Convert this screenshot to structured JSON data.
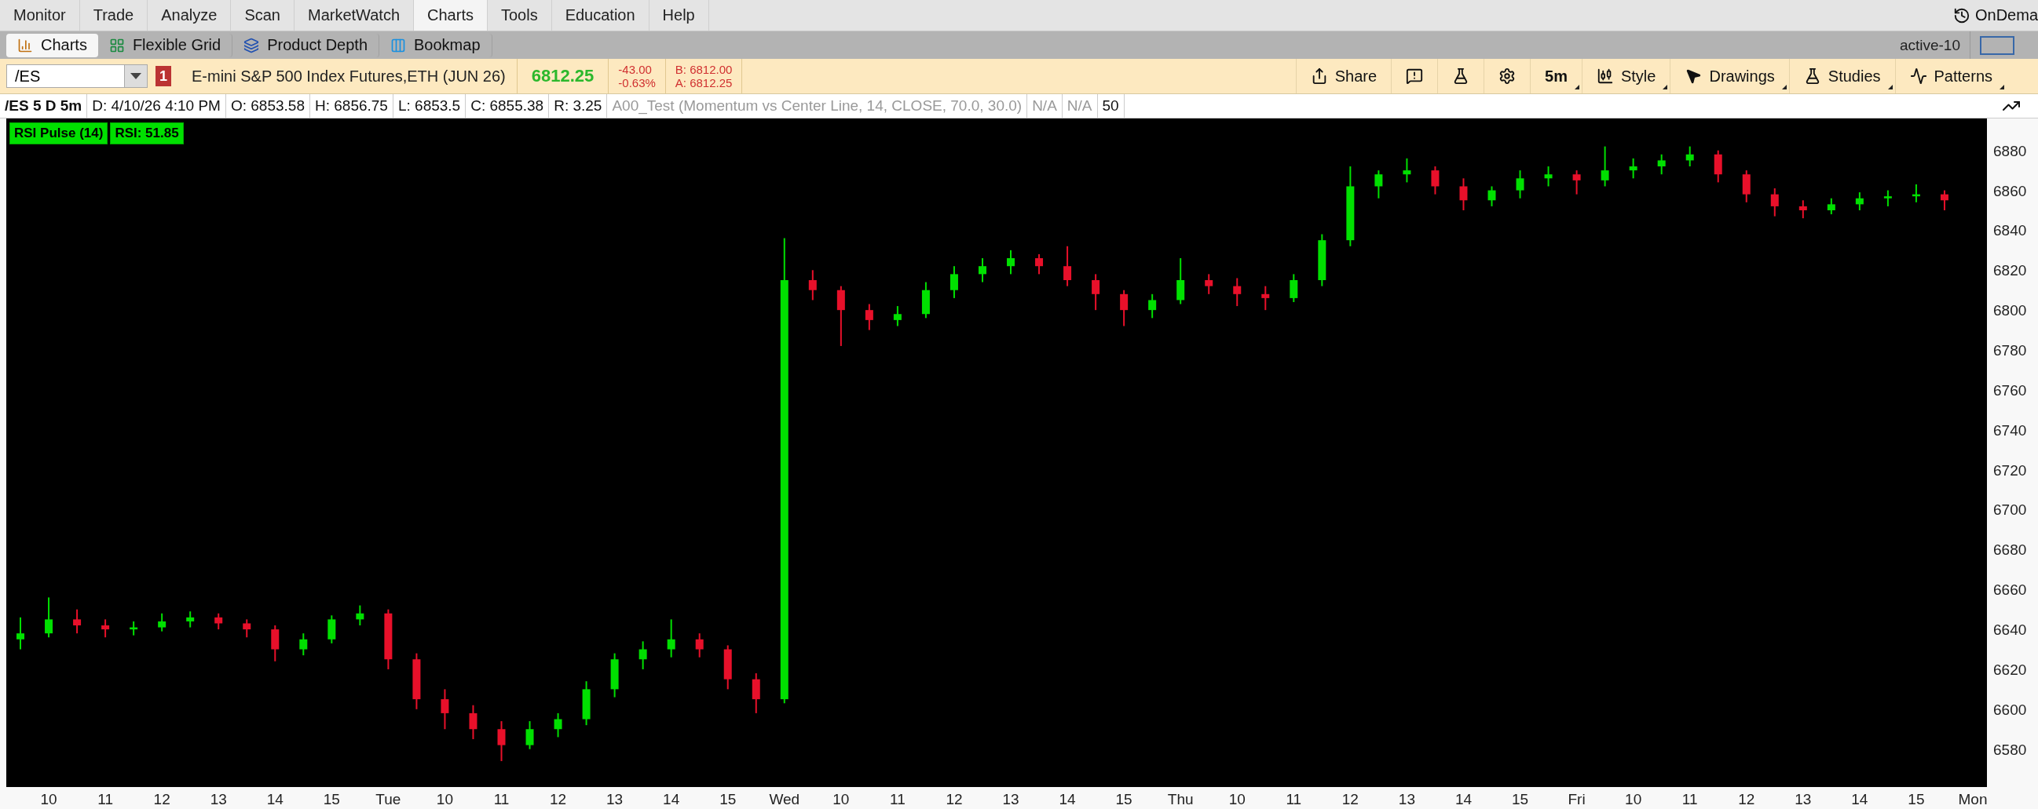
{
  "menu_tabs": [
    {
      "label": "Monitor",
      "selected": false
    },
    {
      "label": "Trade",
      "selected": false
    },
    {
      "label": "Analyze",
      "selected": false
    },
    {
      "label": "Scan",
      "selected": false
    },
    {
      "label": "MarketWatch",
      "selected": false
    },
    {
      "label": "Charts",
      "selected": true
    },
    {
      "label": "Tools",
      "selected": false
    },
    {
      "label": "Education",
      "selected": false
    },
    {
      "label": "Help",
      "selected": false
    }
  ],
  "ondemand": "OnDema",
  "sub_tabs": [
    {
      "label": "Charts",
      "kind": "bars",
      "selected": true
    },
    {
      "label": "Flexible Grid",
      "kind": "grid",
      "selected": false
    },
    {
      "label": "Product Depth",
      "kind": "depth",
      "selected": false
    },
    {
      "label": "Bookmap",
      "kind": "columns",
      "selected": false
    }
  ],
  "workspace": "active-10",
  "symbol_bar": {
    "symbol": "/ES",
    "alert_count": "1",
    "description": "E-mini S&P 500 Index Futures,ETH (JUN 26)",
    "last": "6812.25",
    "change": "-43.00",
    "change_pct": "-0.63%",
    "bid": "B: 6812.00",
    "ask": "A: 6812.25"
  },
  "toolbar": [
    {
      "kind": "share",
      "label": "Share"
    },
    {
      "kind": "alert"
    },
    {
      "kind": "flask"
    },
    {
      "kind": "gear"
    },
    {
      "kind": "interval",
      "label": "5m",
      "has_menu": true
    },
    {
      "kind": "style",
      "label": "Style",
      "has_menu": true
    },
    {
      "kind": "drawings",
      "label": "Drawings",
      "has_menu": true
    },
    {
      "kind": "studies",
      "label": "Studies",
      "has_menu": true
    },
    {
      "kind": "patterns",
      "label": "Patterns",
      "has_menu": true
    }
  ],
  "info_bar": [
    {
      "kind": "title",
      "text": "/ES 5 D 5m"
    },
    {
      "kind": "value",
      "text": "D: 4/10/26 4:10 PM"
    },
    {
      "kind": "value",
      "text": "O: 6853.58"
    },
    {
      "kind": "value",
      "text": "H: 6856.75"
    },
    {
      "kind": "value",
      "text": "L: 6853.5"
    },
    {
      "kind": "value",
      "text": "C: 6855.38"
    },
    {
      "kind": "value",
      "text": "R: 3.25"
    },
    {
      "kind": "study",
      "text": "A00_Test (Momentum vs Center Line, 14, CLOSE, 70.0, 30.0)"
    },
    {
      "kind": "study",
      "text": "N/A"
    },
    {
      "kind": "study",
      "text": "N/A"
    },
    {
      "kind": "value",
      "text": "50"
    }
  ],
  "study_labels": [
    "RSI Pulse (14)",
    "RSI: 51.85"
  ],
  "chart_data": {
    "type": "candlestick",
    "categories": [
      null,
      "10",
      null,
      "11",
      null,
      "12",
      null,
      "13",
      null,
      "14",
      null,
      "15",
      null,
      "Tue",
      null,
      "10",
      null,
      "11",
      null,
      "12",
      null,
      "13",
      null,
      "14",
      null,
      "15",
      null,
      "Wed",
      null,
      "10",
      null,
      "11",
      null,
      "12",
      null,
      "13",
      null,
      "14",
      null,
      "15",
      null,
      "Thu",
      null,
      "10",
      null,
      "11",
      null,
      "12",
      null,
      "13",
      null,
      "14",
      null,
      "15",
      null,
      "Fri",
      null,
      "10",
      null,
      "11",
      null,
      "12",
      null,
      "13",
      null,
      "14",
      null,
      "15",
      null,
      "Mon"
    ],
    "ohlc": [
      [
        6635,
        6646,
        6630,
        6638
      ],
      [
        6638,
        6656,
        6636,
        6645
      ],
      [
        6645,
        6650,
        6638,
        6642
      ],
      [
        6642,
        6645,
        6636,
        6640
      ],
      [
        6640,
        6644,
        6637,
        6641
      ],
      [
        6641,
        6648,
        6639,
        6644
      ],
      [
        6644,
        6649,
        6641,
        6646
      ],
      [
        6646,
        6648,
        6640,
        6643
      ],
      [
        6643,
        6645,
        6636,
        6640
      ],
      [
        6640,
        6642,
        6624,
        6630
      ],
      [
        6630,
        6638,
        6627,
        6635
      ],
      [
        6635,
        6647,
        6633,
        6645
      ],
      [
        6645,
        6652,
        6642,
        6648
      ],
      [
        6648,
        6650,
        6620,
        6625
      ],
      [
        6625,
        6628,
        6600,
        6605
      ],
      [
        6605,
        6610,
        6590,
        6598
      ],
      [
        6598,
        6602,
        6585,
        6590
      ],
      [
        6590,
        6594,
        6574,
        6582
      ],
      [
        6582,
        6594,
        6580,
        6590
      ],
      [
        6590,
        6598,
        6586,
        6595
      ],
      [
        6595,
        6614,
        6592,
        6610
      ],
      [
        6610,
        6628,
        6606,
        6625
      ],
      [
        6625,
        6634,
        6620,
        6630
      ],
      [
        6630,
        6645,
        6626,
        6635
      ],
      [
        6635,
        6638,
        6626,
        6630
      ],
      [
        6630,
        6632,
        6610,
        6615
      ],
      [
        6615,
        6618,
        6598,
        6605
      ],
      [
        6605,
        6836,
        6603,
        6815
      ],
      [
        6815,
        6820,
        6805,
        6810
      ],
      [
        6810,
        6812,
        6782,
        6800
      ],
      [
        6800,
        6803,
        6790,
        6795
      ],
      [
        6795,
        6802,
        6792,
        6798
      ],
      [
        6798,
        6814,
        6796,
        6810
      ],
      [
        6810,
        6822,
        6806,
        6818
      ],
      [
        6818,
        6826,
        6814,
        6822
      ],
      [
        6822,
        6830,
        6818,
        6826
      ],
      [
        6826,
        6828,
        6818,
        6822
      ],
      [
        6822,
        6832,
        6812,
        6815
      ],
      [
        6815,
        6818,
        6800,
        6808
      ],
      [
        6808,
        6810,
        6792,
        6800
      ],
      [
        6800,
        6808,
        6796,
        6805
      ],
      [
        6805,
        6826,
        6803,
        6815
      ],
      [
        6815,
        6818,
        6808,
        6812
      ],
      [
        6812,
        6816,
        6802,
        6808
      ],
      [
        6808,
        6812,
        6800,
        6806
      ],
      [
        6806,
        6818,
        6804,
        6815
      ],
      [
        6815,
        6838,
        6812,
        6835
      ],
      [
        6835,
        6872,
        6832,
        6862
      ],
      [
        6862,
        6870,
        6856,
        6868
      ],
      [
        6868,
        6876,
        6864,
        6870
      ],
      [
        6870,
        6872,
        6858,
        6862
      ],
      [
        6862,
        6866,
        6850,
        6855
      ],
      [
        6855,
        6862,
        6852,
        6860
      ],
      [
        6860,
        6870,
        6856,
        6866
      ],
      [
        6866,
        6872,
        6862,
        6868
      ],
      [
        6868,
        6870,
        6858,
        6865
      ],
      [
        6865,
        6882,
        6862,
        6870
      ],
      [
        6870,
        6876,
        6866,
        6872
      ],
      [
        6872,
        6878,
        6868,
        6875
      ],
      [
        6875,
        6882,
        6872,
        6878
      ],
      [
        6878,
        6880,
        6864,
        6868
      ],
      [
        6868,
        6870,
        6854,
        6858
      ],
      [
        6858,
        6861,
        6847,
        6852
      ],
      [
        6852,
        6855,
        6846,
        6850
      ],
      [
        6850,
        6856,
        6848,
        6853
      ],
      [
        6853,
        6859,
        6850,
        6856
      ],
      [
        6856,
        6860,
        6852,
        6857
      ],
      [
        6857,
        6863,
        6854,
        6858
      ],
      [
        6858,
        6860,
        6850,
        6855
      ],
      null
    ],
    "ylim": [
      6561,
      6896
    ],
    "yticks": [
      6580,
      6600,
      6620,
      6640,
      6660,
      6680,
      6700,
      6720,
      6740,
      6760,
      6780,
      6800,
      6820,
      6840,
      6860,
      6880
    ]
  }
}
